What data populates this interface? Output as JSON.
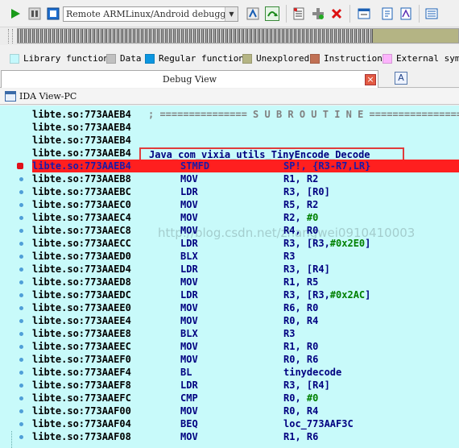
{
  "toolbar": {
    "debugger_select": "Remote ARMLinux/Android debugger",
    "icons": [
      "play-icon",
      "pause-icon",
      "stop-icon",
      "step-into-icon",
      "step-over-icon",
      "breakpoint-list-icon",
      "add-breakpoint-icon",
      "delete-breakpoint-icon",
      "watch-icon",
      "memory-icon",
      "trace-icon",
      "threads-icon"
    ]
  },
  "legend": {
    "items": [
      {
        "label": "Library function",
        "color": "#c4f8fc"
      },
      {
        "label": "Data",
        "color": "#c0c0c0"
      },
      {
        "label": "Regular function",
        "color": "#0c96e0"
      },
      {
        "label": "Unexplored",
        "color": "#b4b484"
      },
      {
        "label": "Instruction",
        "color": "#c07054"
      },
      {
        "label": "External symb",
        "color": "#fcb4fc"
      }
    ]
  },
  "tab": {
    "title": "Debug View",
    "close": "×",
    "alt_icon": "A"
  },
  "view": {
    "title": "IDA View-PC"
  },
  "disasm": {
    "separator": "; =============== S U B R O U T I N E =======================================",
    "function_name": "Java_com_vixia_utils_TinyEncode_Decode",
    "watermark": "http://blog.csdn.net/zhangwei0910410003",
    "lines": [
      {
        "addr": "libte.so:773AAEB4",
        "mnem": "",
        "ops": "",
        "kind": "sep"
      },
      {
        "addr": "libte.so:773AAEB4",
        "mnem": "",
        "ops": ""
      },
      {
        "addr": "libte.so:773AAEB4",
        "mnem": "",
        "ops": ""
      },
      {
        "addr": "libte.so:773AAEB4",
        "mnem": "",
        "ops": "",
        "kind": "func"
      },
      {
        "addr": "libte.so:773AAEB4",
        "mnem": "STMFD",
        "ops": "SP!, {R3-R7,LR}",
        "kind": "current"
      },
      {
        "addr": "libte.so:773AAEB8",
        "mnem": "MOV",
        "ops": "R1, R2"
      },
      {
        "addr": "libte.so:773AAEBC",
        "mnem": "LDR",
        "ops": "R3, [R0]"
      },
      {
        "addr": "libte.so:773AAEC0",
        "mnem": "MOV",
        "ops": "R5, R2"
      },
      {
        "addr": "libte.so:773AAEC4",
        "mnem": "MOV",
        "ops": "R2, ",
        "imm": "#0"
      },
      {
        "addr": "libte.so:773AAEC8",
        "mnem": "MOV",
        "ops": "R4, R0"
      },
      {
        "addr": "libte.so:773AAECC",
        "mnem": "LDR",
        "ops": "R3, [R3,",
        "imm": "#0x2E0",
        "tail": "]"
      },
      {
        "addr": "libte.so:773AAED0",
        "mnem": "BLX",
        "ops": "R3"
      },
      {
        "addr": "libte.so:773AAED4",
        "mnem": "LDR",
        "ops": "R3, [R4]"
      },
      {
        "addr": "libte.so:773AAED8",
        "mnem": "MOV",
        "ops": "R1, R5"
      },
      {
        "addr": "libte.so:773AAEDC",
        "mnem": "LDR",
        "ops": "R3, [R3,",
        "imm": "#0x2AC",
        "tail": "]"
      },
      {
        "addr": "libte.so:773AAEE0",
        "mnem": "MOV",
        "ops": "R6, R0"
      },
      {
        "addr": "libte.so:773AAEE4",
        "mnem": "MOV",
        "ops": "R0, R4"
      },
      {
        "addr": "libte.so:773AAEE8",
        "mnem": "BLX",
        "ops": "R3"
      },
      {
        "addr": "libte.so:773AAEEC",
        "mnem": "MOV",
        "ops": "R1, R0"
      },
      {
        "addr": "libte.so:773AAEF0",
        "mnem": "MOV",
        "ops": "R0, R6"
      },
      {
        "addr": "libte.so:773AAEF4",
        "mnem": "BL",
        "ops": "tinydecode"
      },
      {
        "addr": "libte.so:773AAEF8",
        "mnem": "LDR",
        "ops": "R3, [R4]"
      },
      {
        "addr": "libte.so:773AAEFC",
        "mnem": "CMP",
        "ops": "R0, ",
        "imm": "#0"
      },
      {
        "addr": "libte.so:773AAF00",
        "mnem": "MOV",
        "ops": "R0, R4"
      },
      {
        "addr": "libte.so:773AAF04",
        "mnem": "BEQ",
        "ops": "loc_773AAF3C"
      },
      {
        "addr": "libte.so:773AAF08",
        "mnem": "MOV",
        "ops": "R1, R6"
      }
    ]
  }
}
